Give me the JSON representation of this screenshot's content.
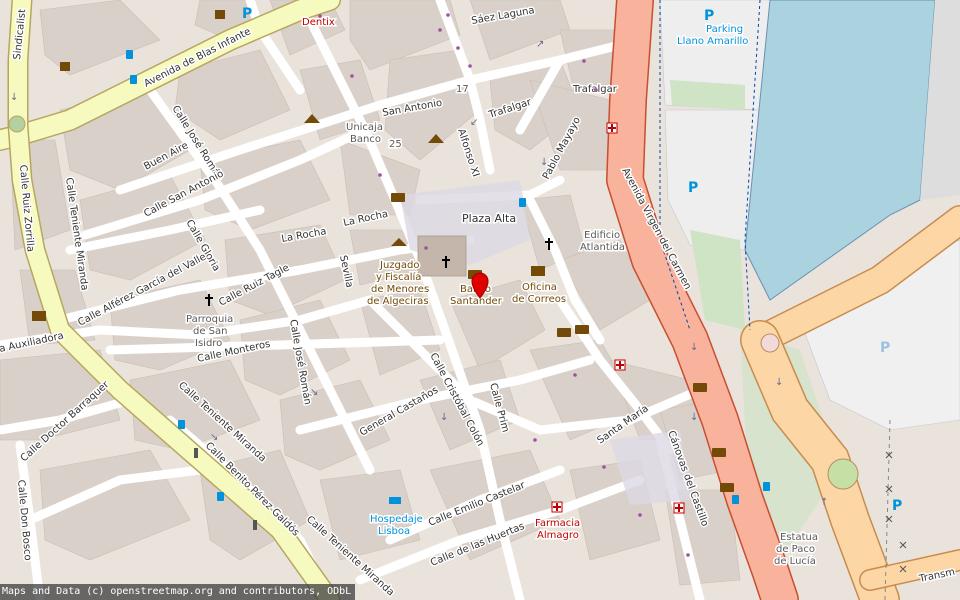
{
  "map": {
    "streets": {
      "blas_infante": "Avenida de Blas Infante",
      "sindicalista": "Sindicalist",
      "saez_laguna": "Sáez Laguna",
      "san_antonio": "San Antonio",
      "trafalgar_1": "Trafalgar",
      "trafalgar_2": "Trafalgar",
      "alfonso_xi": "Alfonso XI",
      "pablo_mayayo": "Pablo Mayayo",
      "virgen_carmen": "Avenida Virgen del Carmen",
      "buen_aire": "Buen Aire",
      "calle_jose_roman_1": "Calle José Román",
      "calle_san_antonio": "Calle San Antonio",
      "calle_gloria": "Calle Gloria",
      "la_rocha_1": "La Rocha",
      "la_rocha_2": "La Rocha",
      "ruiz_zorrilla": "Calle Ruiz Zorrilla",
      "teniente_miranda_1": "Calle Teniente Miranda",
      "alferez_garcia": "Calle Alférez García del Valle",
      "ruiz_tagle": "Calle Ruiz Tagle",
      "sevilla": "Sevilla",
      "auxiliadora": "a Auxiliadora",
      "monteros": "Calle Monteros",
      "jose_roman_2": "Calle José Román",
      "doctor_barraquer": "Calle Doctor Barraquer",
      "teniente_miranda_2": "Calle Teniente Miranda",
      "general_castanos": "General Castaños",
      "cristobal_colon": "Calle Cristóbal Colón",
      "prim": "Calle Prim",
      "santa_maria": "Santa María",
      "canovas": "Cánovas del Castillo",
      "don_bosco": "Calle Don Bosco",
      "benito_perez": "Calle Benito Pérez Galdós",
      "teniente_miranda_3": "Calle Teniente Miranda",
      "emilio_castelar": "Calle Emilio Castelar",
      "de_las_huertas": "Calle de las Huertas",
      "transm": "Transm"
    },
    "places": {
      "plaza_alta": "Plaza Alta",
      "parking_1": "Parking",
      "parking_2": "Llano Amarillo",
      "dentix": "Dentix",
      "unicaja_1": "Unicaja",
      "unicaja_2": "Banco",
      "number_17": "17",
      "number_25": "25",
      "edificio_1": "Edificio",
      "edificio_2": "Atlantida",
      "juzgado_1": "Juzgado",
      "juzgado_2": "y Fiscalía",
      "juzgado_3": "de Menores",
      "juzgado_4": "de Algeciras",
      "banco_1": "Banco",
      "banco_2": "Santander",
      "correos_1": "Oficina",
      "correos_2": "de Correos",
      "parroquia_1": "Parroquia",
      "parroquia_2": "de San",
      "parroquia_3": "Isidro",
      "hospedaje_1": "Hospedaje",
      "hospedaje_2": "Lisboa",
      "farmacia_1": "Farmacia",
      "farmacia_2": "Almagro",
      "estatua_1": "Estatua",
      "estatua_2": "de Paco",
      "estatua_3": "de Lucía",
      "parking_p1": "P",
      "parking_p2": "P",
      "parking_p3": "P",
      "parking_p4": "P",
      "parking_p5": "P"
    },
    "icons": [
      "marker-pin-icon",
      "church-icon",
      "bank-icon",
      "post-office-icon",
      "pharmacy-icon",
      "hotel-icon",
      "courthouse-icon",
      "bus-stop-icon",
      "dentist-icon",
      "shop-icon",
      "museum-icon",
      "parking-icon",
      "theatre-icon",
      "traffic-signal-icon",
      "fuel-icon"
    ],
    "colors": {
      "land": "#e9e3dc",
      "buildings": "#d9d0c9",
      "residential": "#e0dfdf",
      "primary_road": "#f7fabf",
      "trunk_road": "#f9b29c",
      "trunk_casing": "#c84e2f",
      "roundabout": "#fcd6a4",
      "water": "#aad3df",
      "parking_area": "#eeeeee",
      "marker": "#e00000"
    }
  },
  "attribution": "Maps and Data (c) openstreetmap.org and contributors, ODbL"
}
